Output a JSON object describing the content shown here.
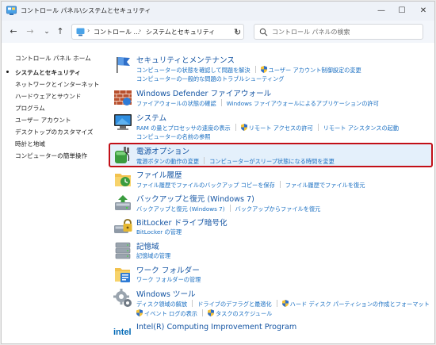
{
  "window": {
    "title": "コントロール パネル\\システムとセキュリティ",
    "controls": {
      "minimize": "—",
      "maximize": "☐",
      "close": "✕"
    }
  },
  "nav": {
    "back": "←",
    "forward": "→",
    "dropdown": "⌄",
    "up": "↑",
    "breadcrumb": [
      "コントロール ...",
      "システムとセキュリティ"
    ],
    "breadcrumb_separator": "›",
    "address_dropdown": "⌄",
    "refresh": "↻",
    "search_placeholder": "コントロール パネルの検索"
  },
  "sidebar": {
    "items": [
      {
        "label": "コントロール パネル ホーム",
        "active": false
      },
      {
        "label": "システムとセキュリティ",
        "active": true
      },
      {
        "label": "ネットワークとインターネット",
        "active": false
      },
      {
        "label": "ハードウェアとサウンド",
        "active": false
      },
      {
        "label": "プログラム",
        "active": false
      },
      {
        "label": "ユーザー アカウント",
        "active": false
      },
      {
        "label": "デスクトップのカスタマイズ",
        "active": false
      },
      {
        "label": "時計と地域",
        "active": false
      },
      {
        "label": "コンピューターの簡単操作",
        "active": false
      }
    ]
  },
  "categories": [
    {
      "title": "セキュリティとメンテナンス",
      "icon": "flag-icon",
      "lines": [
        [
          {
            "text": "コンピューターの状態を確認して問題を解決"
          },
          {
            "text": "ユーザー アカウント制御設定の変更",
            "shield": true
          }
        ],
        [
          {
            "text": "コンピューターの一般的な問題のトラブルシューティング"
          }
        ]
      ]
    },
    {
      "title": "Windows Defender ファイアウォール",
      "icon": "firewall-icon",
      "lines": [
        [
          {
            "text": "ファイアウォールの状態の確認"
          },
          {
            "text": "Windows ファイアウォールによるアプリケーションの許可"
          }
        ]
      ]
    },
    {
      "title": "システム",
      "icon": "computer-icon",
      "lines": [
        [
          {
            "text": "RAM の量とプロセッサの速度の表示"
          },
          {
            "text": "リモート アクセスの許可",
            "shield": true
          },
          {
            "text": "リモート アシスタンスの起動"
          }
        ],
        [
          {
            "text": "コンピューターの名前の参照"
          }
        ]
      ]
    },
    {
      "title": "電源オプション",
      "icon": "power-icon",
      "highlighted": true,
      "lines": [
        [
          {
            "text": "電源ボタンの動作の変更"
          },
          {
            "text": "コンピューターがスリープ状態になる時間を変更"
          }
        ]
      ]
    },
    {
      "title": "ファイル履歴",
      "icon": "file-history-icon",
      "lines": [
        [
          {
            "text": "ファイル履歴でファイルのバックアップ コピーを保存"
          },
          {
            "text": "ファイル履歴でファイルを復元"
          }
        ]
      ]
    },
    {
      "title": "バックアップと復元 (Windows 7)",
      "icon": "backup-icon",
      "lines": [
        [
          {
            "text": "バックアップと復元 (Windows 7)"
          },
          {
            "text": "バックアップからファイルを復元"
          }
        ]
      ]
    },
    {
      "title": "BitLocker ドライブ暗号化",
      "icon": "bitlocker-icon",
      "lines": [
        [
          {
            "text": "BitLocker の管理"
          }
        ]
      ]
    },
    {
      "title": "記憶域",
      "icon": "storage-icon",
      "lines": [
        [
          {
            "text": "記憶域の管理"
          }
        ]
      ]
    },
    {
      "title": "ワーク フォルダー",
      "icon": "work-folders-icon",
      "lines": [
        [
          {
            "text": "ワーク フォルダーの管理"
          }
        ]
      ]
    },
    {
      "title": "Windows ツール",
      "icon": "tools-icon",
      "lines": [
        [
          {
            "text": "ディスク領域の解放"
          },
          {
            "text": "ドライブのデフラグと最適化"
          },
          {
            "text": "ハード ディスク パーティションの作成とフォーマット",
            "shield": true
          }
        ],
        [
          {
            "text": "イベント ログの表示",
            "shield": true
          },
          {
            "text": "タスクのスケジュール",
            "shield": true
          }
        ]
      ]
    },
    {
      "title": "Intel(R) Computing Improvement Program",
      "icon": "intel-icon",
      "lines": []
    }
  ]
}
